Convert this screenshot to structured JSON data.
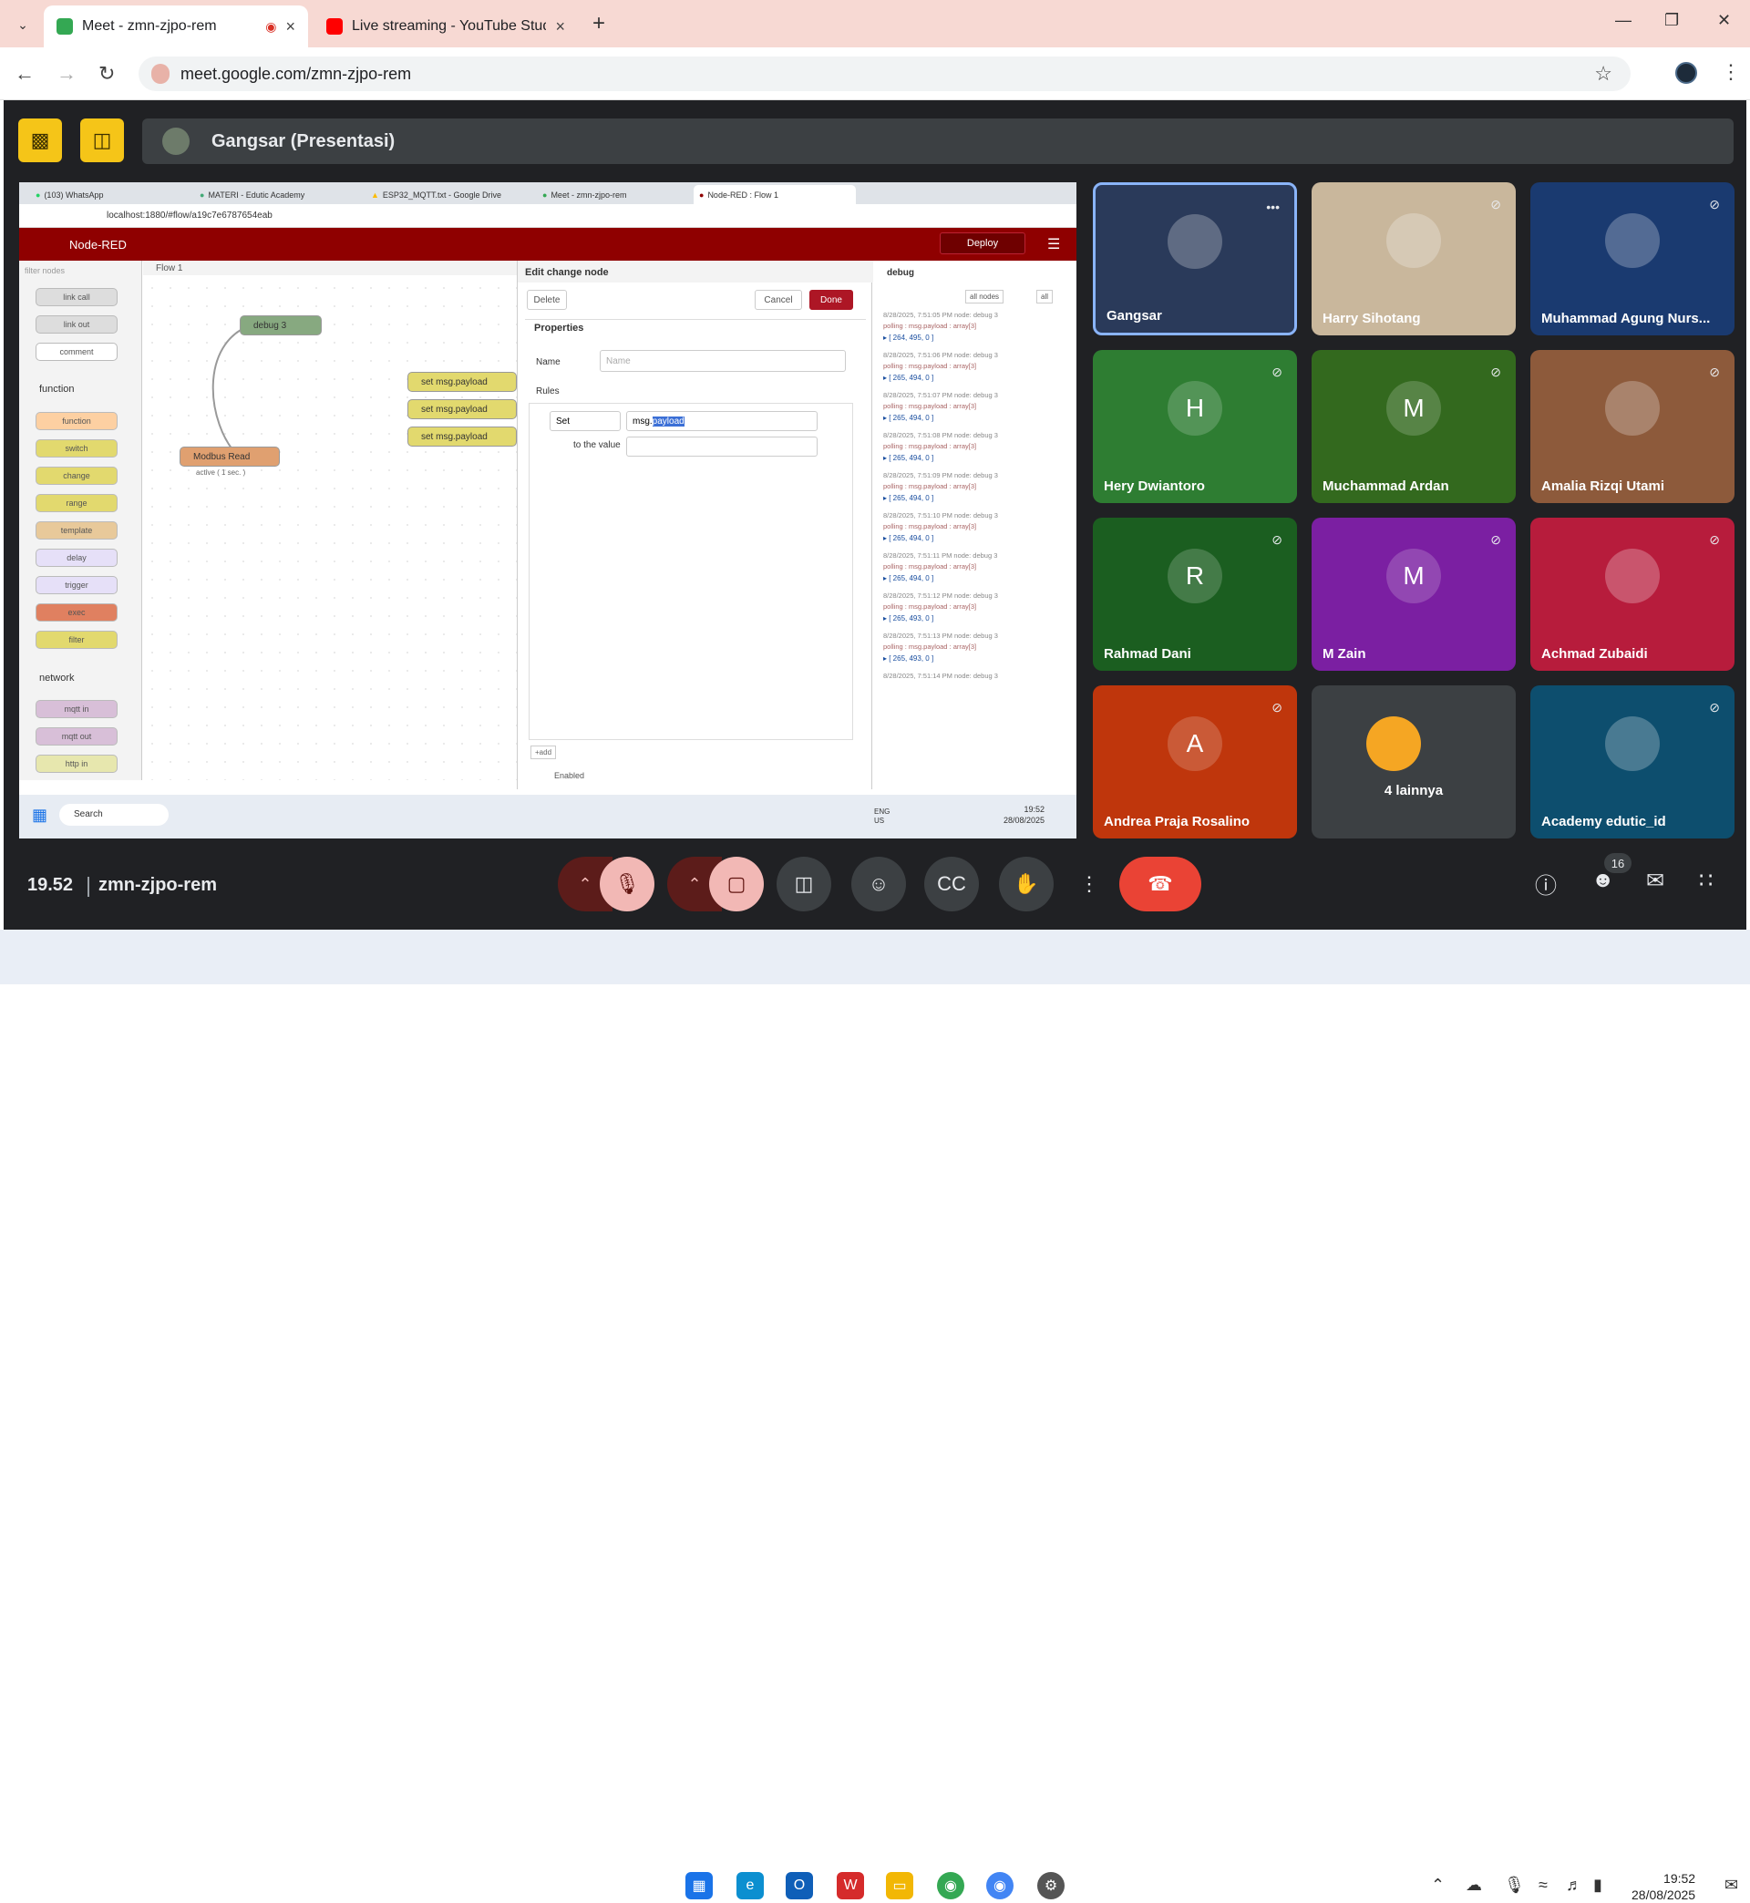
{
  "browser": {
    "tabs": [
      {
        "title": "Meet - zmn-zjpo-rem",
        "active": true
      },
      {
        "title": "Live streaming - YouTube Studi",
        "active": false
      }
    ],
    "url": "meet.google.com/zmn-zjpo-rem"
  },
  "meet": {
    "presenter_label": "Gangsar (Presentasi)",
    "time": "19.52",
    "meeting_code": "zmn-zjpo-rem",
    "participant_count": "16",
    "participants": [
      {
        "name": "Gangsar",
        "initial": "",
        "color": "#2a3a5a"
      },
      {
        "name": "Harry Sihotang",
        "initial": "",
        "color": "#c9b79c"
      },
      {
        "name": "Muhammad Agung Nurs...",
        "initial": "",
        "color": "#1a3a70"
      },
      {
        "name": "Hery Dwiantoro",
        "initial": "H",
        "color": "#2e7d32"
      },
      {
        "name": "Muchammad Ardan",
        "initial": "M",
        "color": "#33691e"
      },
      {
        "name": "Amalia Rizqi Utami",
        "initial": "",
        "color": "#8d5a3b"
      },
      {
        "name": "Rahmad Dani",
        "initial": "R",
        "color": "#1b5e20"
      },
      {
        "name": "M Zain",
        "initial": "M",
        "color": "#7b1fa2"
      },
      {
        "name": "Achmad Zubaidi",
        "initial": "",
        "color": "#b71c3c"
      },
      {
        "name": "Andrea Praja Rosalino",
        "initial": "A",
        "color": "#bf360c"
      },
      {
        "name": "4 lainnya",
        "initial": "",
        "color": "#3c4043"
      },
      {
        "name": "Academy edutic_id",
        "initial": "",
        "color": "#0d4e6e"
      }
    ]
  },
  "shared": {
    "tabs": [
      "(103) WhatsApp",
      "MATERI - Edutic Academy",
      "ESP32_MQTT.txt - Google Drive",
      "Meet - zmn-zjpo-rem",
      "Node-RED : Flow 1"
    ],
    "url": "localhost:1880/#flow/a19c7e6787654eab",
    "app_title": "Node-RED",
    "deploy": "Deploy",
    "flow_tab": "Flow 1",
    "filter_placeholder": "filter nodes",
    "palette_top": [
      "link call",
      "link out",
      "comment"
    ],
    "cat_function": "function",
    "palette_function": [
      "function",
      "switch",
      "change",
      "range",
      "template",
      "delay",
      "trigger",
      "exec",
      "filter"
    ],
    "cat_network": "network",
    "palette_network": [
      "mqtt in",
      "mqtt out",
      "http in"
    ],
    "flow_nodes": {
      "debug": "debug 3",
      "modbus": "Modbus Read",
      "modbus_status": "active ( 1 sec. )",
      "set": "set msg.payload"
    },
    "editor": {
      "title": "Edit change node",
      "delete": "Delete",
      "cancel": "Cancel",
      "done": "Done",
      "properties": "Properties",
      "name_label": "Name",
      "name_placeholder": "Name",
      "rules_label": "Rules",
      "action": "Set",
      "target_prefix": "msg.",
      "target_value": "payload",
      "to_value": "to the value",
      "add": "+add",
      "enabled": "Enabled"
    },
    "debug": {
      "tab": "debug",
      "filter": "all nodes",
      "clear": "all",
      "messages": [
        {
          "time": "8/28/2025, 7:51:05 PM",
          "node": "node: debug 3",
          "topic": "polling : msg.payload : array[3]",
          "value": "[ 264, 495, 0 ]"
        },
        {
          "time": "8/28/2025, 7:51:06 PM",
          "node": "node: debug 3",
          "topic": "polling : msg.payload : array[3]",
          "value": "[ 265, 494, 0 ]"
        },
        {
          "time": "8/28/2025, 7:51:07 PM",
          "node": "node: debug 3",
          "topic": "polling : msg.payload : array[3]",
          "value": "[ 265, 494, 0 ]"
        },
        {
          "time": "8/28/2025, 7:51:08 PM",
          "node": "node: debug 3",
          "topic": "polling : msg.payload : array[3]",
          "value": "[ 265, 494, 0 ]"
        },
        {
          "time": "8/28/2025, 7:51:09 PM",
          "node": "node: debug 3",
          "topic": "polling : msg.payload : array[3]",
          "value": "[ 265, 494, 0 ]"
        },
        {
          "time": "8/28/2025, 7:51:10 PM",
          "node": "node: debug 3",
          "topic": "polling : msg.payload : array[3]",
          "value": "[ 265, 494, 0 ]"
        },
        {
          "time": "8/28/2025, 7:51:11 PM",
          "node": "node: debug 3",
          "topic": "polling : msg.payload : array[3]",
          "value": "[ 265, 494, 0 ]"
        },
        {
          "time": "8/28/2025, 7:51:12 PM",
          "node": "node: debug 3",
          "topic": "polling : msg.payload : array[3]",
          "value": "[ 265, 493, 0 ]"
        },
        {
          "time": "8/28/2025, 7:51:13 PM",
          "node": "node: debug 3",
          "topic": "polling : msg.payload : array[3]",
          "value": "[ 265, 493, 0 ]"
        },
        {
          "time": "8/28/2025, 7:51:14 PM",
          "node": "node: debug 3",
          "topic": "",
          "value": ""
        }
      ]
    },
    "taskbar": {
      "search": "Search",
      "lang": "ENG",
      "region": "US",
      "time": "19:52",
      "date": "28/08/2025"
    }
  },
  "windows": {
    "time": "19:52",
    "date": "28/08/2025"
  }
}
